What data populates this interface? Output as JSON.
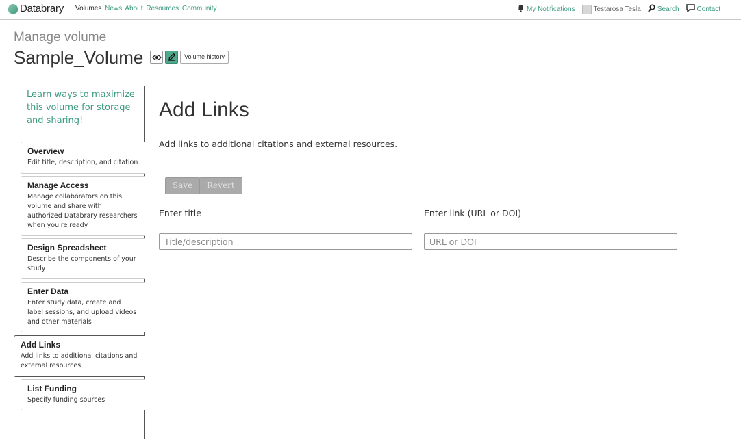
{
  "nav": {
    "brand": "Databrary",
    "links": [
      "Volumes",
      "News",
      "About",
      "Resources",
      "Community"
    ],
    "notifications": "My Notifications",
    "user": "Testarosa Tesla",
    "search": "Search",
    "contact": "Contact"
  },
  "header": {
    "subtitle": "Manage volume",
    "volume_title": "Sample_Volume",
    "history_button": "Volume history"
  },
  "sidebar": {
    "tip": "Learn ways to maximize this volume for storage and sharing!",
    "items": [
      {
        "title": "Overview",
        "desc": "Edit title, description, and citation"
      },
      {
        "title": "Manage Access",
        "desc": "Manage collaborators on this volume and share with authorized Databrary researchers when you're ready"
      },
      {
        "title": "Design Spreadsheet",
        "desc": "Describe the components of your study"
      },
      {
        "title": "Enter Data",
        "desc": "Enter study data, create and label sessions, and upload videos and other materials"
      },
      {
        "title": "Add Links",
        "desc": "Add links to additional citations and external resources"
      },
      {
        "title": "List Funding",
        "desc": "Specify funding sources"
      }
    ]
  },
  "main": {
    "title": "Add Links",
    "description": "Add links to additional citations and external resources.",
    "save_label": "Save",
    "revert_label": "Revert",
    "title_label": "Enter title",
    "title_placeholder": "Title/description",
    "link_label": "Enter link (URL or DOI)",
    "link_placeholder": "URL or DOI"
  },
  "colors": {
    "accent": "#3c9a80",
    "active_edit": "#4fa98c",
    "disabled_button": "#aaaaaa"
  }
}
